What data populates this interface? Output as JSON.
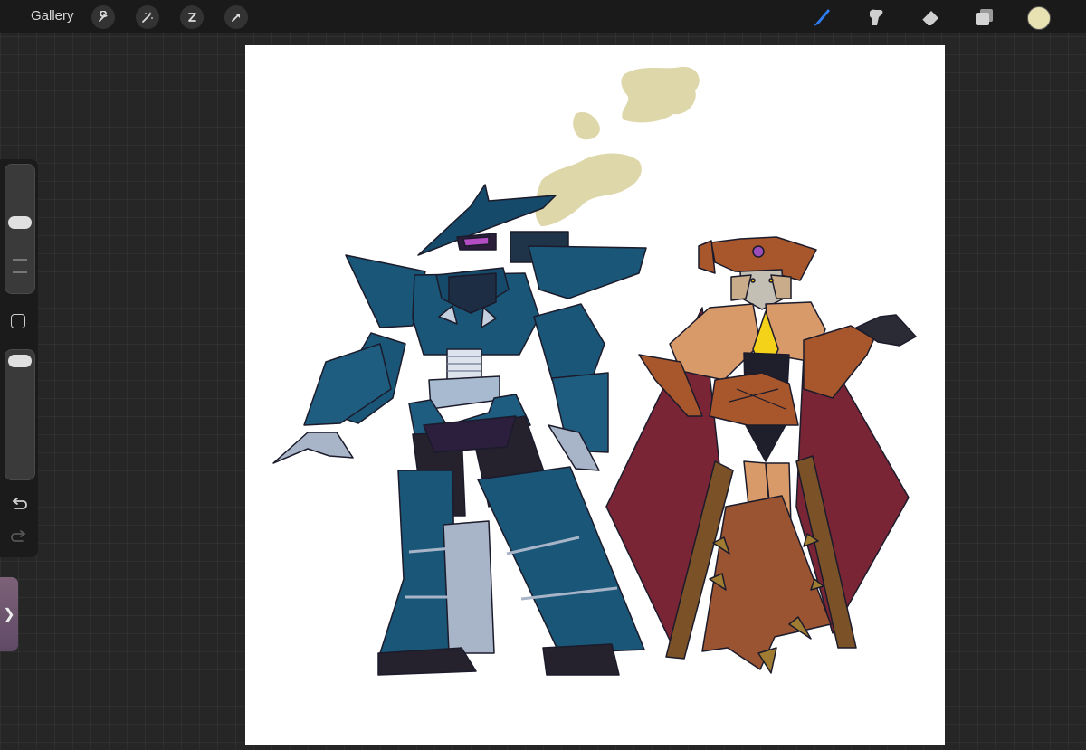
{
  "topbar": {
    "gallery_label": "Gallery",
    "left_tools": [
      "wrench-icon",
      "magic-wand-icon",
      "selection-icon",
      "transform-arrow-icon"
    ],
    "right_tools": [
      "brush-icon",
      "smudge-icon",
      "eraser-icon",
      "layers-icon"
    ],
    "active_tool": "brush-icon",
    "active_color": "#e8e2b3",
    "accent_color": "#2f7df6"
  },
  "sidebar": {
    "brush_size_level": 0.2,
    "brush_opacity_level": 0.05,
    "controls": [
      "brush-size-slider",
      "modify-button",
      "opacity-slider",
      "undo-icon",
      "redo-icon"
    ]
  },
  "canvas": {
    "background": "#ffffff",
    "artwork": "two-robot-character-drawing"
  }
}
